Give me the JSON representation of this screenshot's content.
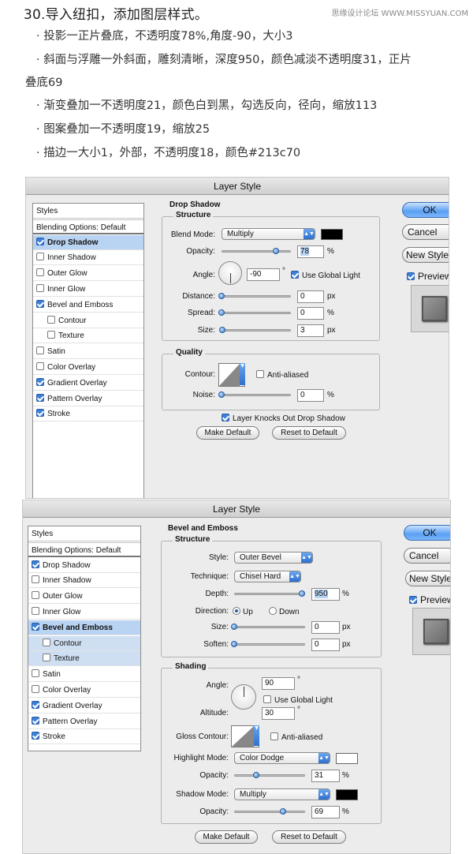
{
  "intro": {
    "heading": "30.导入纽扣，添加图层样式。",
    "source": "思缘设计论坛 WWW.MISSYUAN.COM",
    "lines": [
      "· 投影一正片叠底，不透明度78%,角度-90，大小3",
      "· 斜面与浮雕一外斜面，雕刻清晰，深度950，颜色减淡不透明度31，正片",
      "叠底69",
      "· 渐变叠加一不透明度21，颜色白到黑，勾选反向，径向，缩放113",
      "· 图案叠加一不透明度19，缩放25",
      "· 描边一大小1，外部，不透明度18，颜色#213c70"
    ]
  },
  "dialog1": {
    "title": "Layer Style",
    "styles": [
      {
        "label": "Styles",
        "checkbox": false,
        "checked": false,
        "selected": false
      },
      {
        "label": "Blending Options: Default",
        "checkbox": false,
        "checked": false,
        "selected": false
      },
      {
        "label": "Drop Shadow",
        "checkbox": true,
        "checked": true,
        "selected": true
      },
      {
        "label": "Inner Shadow",
        "checkbox": true,
        "checked": false,
        "selected": false
      },
      {
        "label": "Outer Glow",
        "checkbox": true,
        "checked": false,
        "selected": false
      },
      {
        "label": "Inner Glow",
        "checkbox": true,
        "checked": false,
        "selected": false
      },
      {
        "label": "Bevel and Emboss",
        "checkbox": true,
        "checked": true,
        "selected": false
      },
      {
        "label": "Contour",
        "checkbox": true,
        "checked": false,
        "selected": false,
        "indent": true
      },
      {
        "label": "Texture",
        "checkbox": true,
        "checked": false,
        "selected": false,
        "indent": true
      },
      {
        "label": "Satin",
        "checkbox": true,
        "checked": false,
        "selected": false
      },
      {
        "label": "Color Overlay",
        "checkbox": true,
        "checked": false,
        "selected": false
      },
      {
        "label": "Gradient Overlay",
        "checkbox": true,
        "checked": true,
        "selected": false
      },
      {
        "label": "Pattern Overlay",
        "checkbox": true,
        "checked": true,
        "selected": false
      },
      {
        "label": "Stroke",
        "checkbox": true,
        "checked": true,
        "selected": false
      }
    ],
    "section_title": "Drop Shadow",
    "structure_title": "Structure",
    "blend_mode_label": "Blend Mode:",
    "blend_mode_value": "Multiply",
    "shadow_color": "#000000",
    "opacity_label": "Opacity:",
    "opacity_value": "78",
    "opacity_level": 0.78,
    "angle_label": "Angle:",
    "angle_value": "-90",
    "degree_symbol": "°",
    "use_global_light": "Use Global Light",
    "distance_label": "Distance:",
    "distance_value": "0",
    "spread_label": "Spread:",
    "spread_value": "0",
    "size_label": "Size:",
    "size_value": "3",
    "unit_px": "px",
    "unit_pct": "%",
    "quality_title": "Quality",
    "contour_label": "Contour:",
    "anti_aliased": "Anti-aliased",
    "noise_label": "Noise:",
    "noise_value": "0",
    "knocks_out": "Layer Knocks Out Drop Shadow",
    "make_default": "Make Default",
    "reset_default": "Reset to Default",
    "ok": "OK",
    "cancel": "Cancel",
    "new_style": "New Style...",
    "preview": "Preview"
  },
  "dialog2": {
    "title": "Layer Style",
    "styles": [
      {
        "label": "Styles",
        "checkbox": false,
        "checked": false,
        "selected": false
      },
      {
        "label": "Blending Options: Default",
        "checkbox": false,
        "checked": false,
        "selected": false
      },
      {
        "label": "Drop Shadow",
        "checkbox": true,
        "checked": true,
        "selected": false
      },
      {
        "label": "Inner Shadow",
        "checkbox": true,
        "checked": false,
        "selected": false
      },
      {
        "label": "Outer Glow",
        "checkbox": true,
        "checked": false,
        "selected": false
      },
      {
        "label": "Inner Glow",
        "checkbox": true,
        "checked": false,
        "selected": false
      },
      {
        "label": "Bevel and Emboss",
        "checkbox": true,
        "checked": true,
        "selected": true
      },
      {
        "label": "Contour",
        "checkbox": true,
        "checked": false,
        "selected": false,
        "indent": true,
        "sub": true
      },
      {
        "label": "Texture",
        "checkbox": true,
        "checked": false,
        "selected": false,
        "indent": true,
        "sub": true
      },
      {
        "label": "Satin",
        "checkbox": true,
        "checked": false,
        "selected": false
      },
      {
        "label": "Color Overlay",
        "checkbox": true,
        "checked": false,
        "selected": false
      },
      {
        "label": "Gradient Overlay",
        "checkbox": true,
        "checked": true,
        "selected": false
      },
      {
        "label": "Pattern Overlay",
        "checkbox": true,
        "checked": true,
        "selected": false
      },
      {
        "label": "Stroke",
        "checkbox": true,
        "checked": true,
        "selected": false
      }
    ],
    "section_title": "Bevel and Emboss",
    "structure_title": "Structure",
    "style_label": "Style:",
    "style_value": "Outer Bevel",
    "technique_label": "Technique:",
    "technique_value": "Chisel Hard",
    "depth_label": "Depth:",
    "depth_value": "950",
    "depth_level": 0.95,
    "direction_label": "Direction:",
    "direction_up": "Up",
    "direction_down": "Down",
    "size_label": "Size:",
    "size_value": "0",
    "soften_label": "Soften:",
    "soften_value": "0",
    "unit_px": "px",
    "unit_pct": "%",
    "shading_title": "Shading",
    "angle_label": "Angle:",
    "angle_value": "90",
    "degree_symbol": "°",
    "use_global_light": "Use Global Light",
    "altitude_label": "Altitude:",
    "altitude_value": "30",
    "gloss_contour_label": "Gloss Contour:",
    "anti_aliased": "Anti-aliased",
    "highlight_mode_label": "Highlight Mode:",
    "highlight_mode_value": "Color Dodge",
    "highlight_color": "#ffffff",
    "highlight_opacity_label": "Opacity:",
    "highlight_opacity_value": "31",
    "highlight_opacity_level": 0.31,
    "shadow_mode_label": "Shadow Mode:",
    "shadow_mode_value": "Multiply",
    "shadow_color": "#000000",
    "shadow_opacity_label": "Opacity:",
    "shadow_opacity_value": "69",
    "shadow_opacity_level": 0.69,
    "make_default": "Make Default",
    "reset_default": "Reset to Default",
    "ok": "OK",
    "cancel": "Cancel",
    "new_style": "New Style...",
    "preview": "Preview"
  }
}
